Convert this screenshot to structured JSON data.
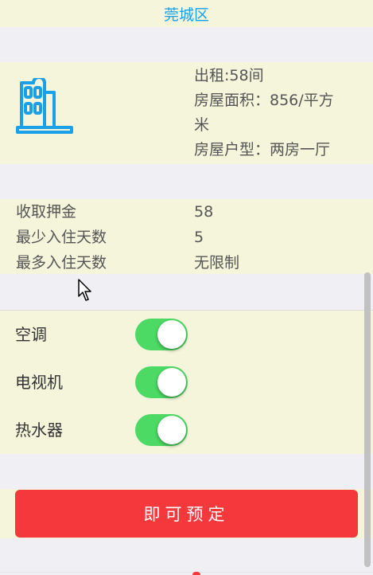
{
  "header": {
    "district": "莞城区"
  },
  "house": {
    "icon": "building-icon",
    "rooms": "出租:58间",
    "area_line1": "房屋面积：856/平方",
    "area_line2": "米",
    "layout": "房屋户型：两房一厅"
  },
  "terms": [
    {
      "label": "收取押金",
      "value": "58"
    },
    {
      "label": "最少入住天数",
      "value": "5"
    },
    {
      "label": "最多入住天数",
      "value": "无限制"
    }
  ],
  "amenities": [
    {
      "label": "空调",
      "enabled": true
    },
    {
      "label": "电视机",
      "enabled": true
    },
    {
      "label": "热水器",
      "enabled": true
    }
  ],
  "actions": {
    "book_label": "即可预定"
  },
  "colors": {
    "accent_blue": "#1aa0e8",
    "toggle_on": "#4cd964",
    "book_red": "#f5383b",
    "band_bg": "#f5f5dc",
    "page_bg": "#efeff4"
  }
}
